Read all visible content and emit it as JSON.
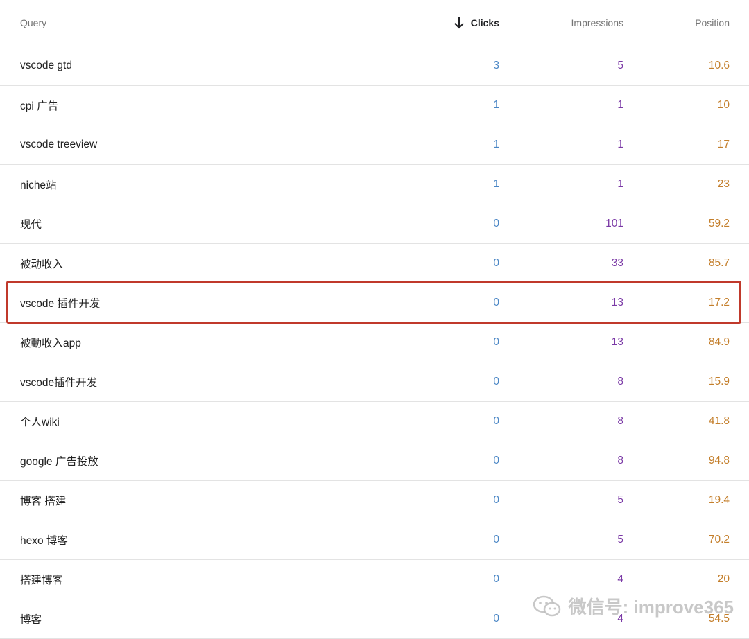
{
  "header": {
    "query": "Query",
    "clicks": "Clicks",
    "impressions": "Impressions",
    "position": "Position"
  },
  "sort_icon": "arrow-down-icon",
  "rows": [
    {
      "query": "vscode gtd",
      "clicks": "3",
      "impressions": "5",
      "position": "10.6"
    },
    {
      "query": "cpi 广告",
      "clicks": "1",
      "impressions": "1",
      "position": "10"
    },
    {
      "query": "vscode treeview",
      "clicks": "1",
      "impressions": "1",
      "position": "17"
    },
    {
      "query": "niche站",
      "clicks": "1",
      "impressions": "1",
      "position": "23"
    },
    {
      "query": "现代",
      "clicks": "0",
      "impressions": "101",
      "position": "59.2"
    },
    {
      "query": "被动收入",
      "clicks": "0",
      "impressions": "33",
      "position": "85.7"
    },
    {
      "query": "vscode 插件开发",
      "clicks": "0",
      "impressions": "13",
      "position": "17.2"
    },
    {
      "query": "被動收入app",
      "clicks": "0",
      "impressions": "13",
      "position": "84.9"
    },
    {
      "query": "vscode插件开发",
      "clicks": "0",
      "impressions": "8",
      "position": "15.9"
    },
    {
      "query": "个人wiki",
      "clicks": "0",
      "impressions": "8",
      "position": "41.8"
    },
    {
      "query": "google 广告投放",
      "clicks": "0",
      "impressions": "8",
      "position": "94.8"
    },
    {
      "query": "博客 搭建",
      "clicks": "0",
      "impressions": "5",
      "position": "19.4"
    },
    {
      "query": "hexo 博客",
      "clicks": "0",
      "impressions": "5",
      "position": "70.2"
    },
    {
      "query": "搭建博客",
      "clicks": "0",
      "impressions": "4",
      "position": "20"
    },
    {
      "query": "博客",
      "clicks": "0",
      "impressions": "4",
      "position": "54.5"
    }
  ],
  "highlighted_row": "vscode 插件开发",
  "watermark": {
    "icon": "wechat-icon",
    "text": "微信号: improve365"
  },
  "colors": {
    "clicks": "#4a86c5",
    "impressions": "#7b3aa6",
    "position": "#c47f2c",
    "highlight": "#c0392b"
  }
}
